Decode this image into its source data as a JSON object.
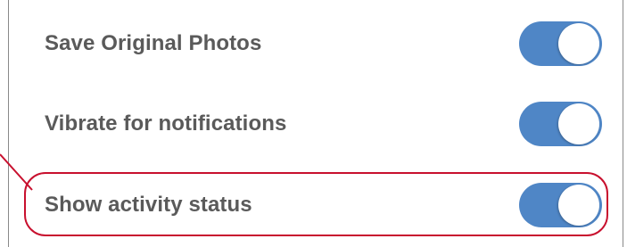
{
  "settings": {
    "items": [
      {
        "label": "Save Original Photos",
        "enabled": true
      },
      {
        "label": "Vibrate for notifications",
        "enabled": true
      },
      {
        "label": "Show activity status",
        "enabled": true
      }
    ]
  },
  "annotation": {
    "highlighted_item": "Show activity status",
    "color": "#c8102e"
  },
  "colors": {
    "toggle_on": "#4f86c6",
    "label_text": "#5a5a5a"
  }
}
